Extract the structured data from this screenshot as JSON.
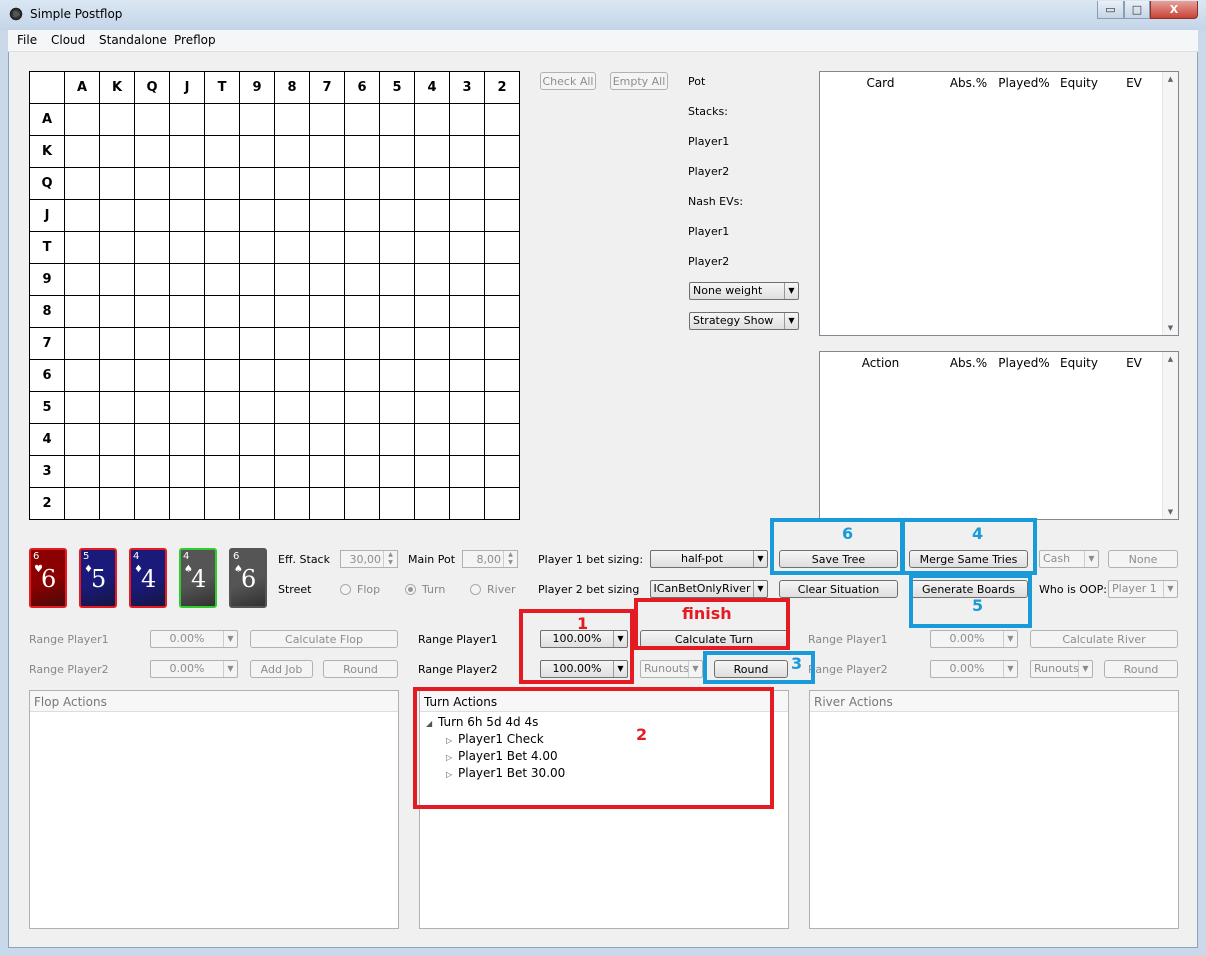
{
  "window": {
    "title": "Simple Postflop",
    "minimize": "▭",
    "maximize": "□",
    "close": "X"
  },
  "menu": [
    "File",
    "Cloud",
    "Standalone",
    "Preflop"
  ],
  "grid": {
    "columns": [
      "A",
      "K",
      "Q",
      "J",
      "T",
      "9",
      "8",
      "7",
      "6",
      "5",
      "4",
      "3",
      "2"
    ],
    "rows": [
      "A",
      "K",
      "Q",
      "J",
      "T",
      "9",
      "8",
      "7",
      "6",
      "5",
      "4",
      "3",
      "2"
    ]
  },
  "range_buttons": {
    "check_all": "Check All",
    "empty_all": "Empty All"
  },
  "info": {
    "pot": "Pot",
    "stacks": "Stacks:",
    "player1": "Player1",
    "player2": "Player2",
    "nash_evs": "Nash EVs:",
    "player1_b": "Player1",
    "player2_b": "Player2"
  },
  "weight_combo": "None weight",
  "strategy_combo": "Strategy Show",
  "card_table": {
    "headers": [
      "Card",
      "Abs.%",
      "Played%",
      "Equity",
      "EV"
    ]
  },
  "action_table": {
    "headers": [
      "Action",
      "Abs.%",
      "Played%",
      "Equity",
      "EV"
    ]
  },
  "cards": [
    {
      "rank": "6",
      "suit": "♥",
      "big": "6",
      "color": "#8b0000",
      "border": "#e41b23"
    },
    {
      "rank": "5",
      "suit": "♦",
      "big": "5",
      "color": "#1a1a7a",
      "border": "#e41b23"
    },
    {
      "rank": "4",
      "suit": "♦",
      "big": "4",
      "color": "#1a1a7a",
      "border": "#e41b23"
    },
    {
      "rank": "4",
      "suit": "♠",
      "big": "4",
      "color": "#555555",
      "border": "#2ecc2e"
    },
    {
      "rank": "6",
      "suit": "♠",
      "big": "6",
      "color": "#555555",
      "border": "#555555"
    }
  ],
  "eff_stack": {
    "label": "Eff. Stack",
    "value": "30,00"
  },
  "main_pot": {
    "label": "Main Pot",
    "value": "8,00"
  },
  "street": {
    "label": "Street",
    "flop": "Flop",
    "turn": "Turn",
    "river": "River"
  },
  "sizing": {
    "p1_label": "Player 1 bet sizing:",
    "p1_value": "half-pot",
    "p2_label": "Player 2 bet sizing",
    "p2_value": "ICanBetOnlyRiver"
  },
  "buttons": {
    "save_tree": "Save Tree",
    "merge": "Merge Same Tries",
    "clear": "Clear Situation",
    "generate": "Generate Boards",
    "cash": "Cash",
    "none": "None",
    "who_oop": "Who is OOP:",
    "oop_value": "Player 1"
  },
  "flop_panel": {
    "range_p1": "Range Player1",
    "range_p2": "Range Player2",
    "p1_value": "0.00%",
    "p2_value": "0.00%",
    "calc": "Calculate Flop",
    "add_job": "Add Job",
    "round": "Round"
  },
  "turn_panel": {
    "range_p1": "Range Player1",
    "range_p2": "Range Player2",
    "p1_value": "100.00%",
    "p2_value": "100.00%",
    "calc": "Calculate Turn",
    "runouts": "Runouts",
    "round": "Round"
  },
  "river_panel": {
    "range_p1": "Range Player1",
    "range_p2": "Range Player2",
    "p1_value": "0.00%",
    "p2_value": "0.00%",
    "calc": "Calculate River",
    "runouts": "Runouts",
    "round": "Round"
  },
  "groups": {
    "flop": "Flop Actions",
    "turn": "Turn Actions",
    "river": "River Actions"
  },
  "turn_tree": {
    "root": "Turn 6h 5d 4d 4s",
    "children": [
      "Player1 Check",
      "Player1 Bet 4.00",
      "Player1 Bet 30.00"
    ]
  },
  "annotations": {
    "n1": "1",
    "n2": "2",
    "n3": "3",
    "n4": "4",
    "n5": "5",
    "n6": "6",
    "finish": "finish",
    "red": "#e41b23",
    "blue": "#189bd8"
  }
}
